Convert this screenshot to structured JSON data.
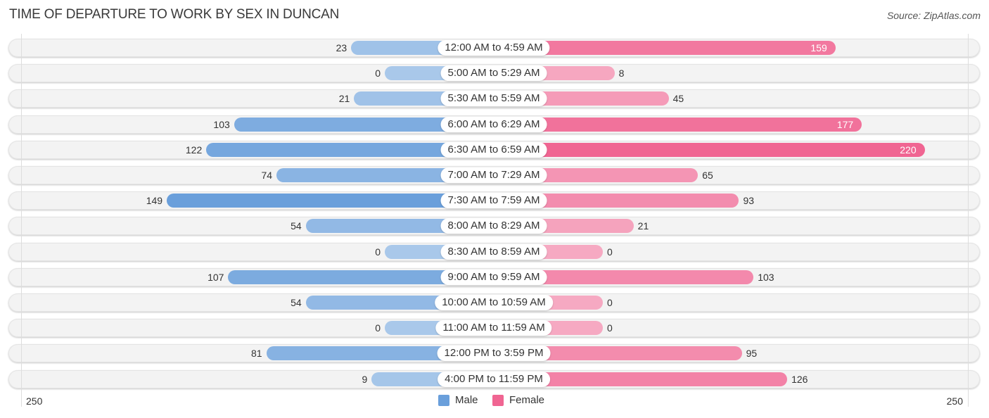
{
  "title": "TIME OF DEPARTURE TO WORK BY SEX IN DUNCAN",
  "source": "Source: ZipAtlas.com",
  "colors": {
    "male": "#6a9fdb",
    "male_light": "#a9c8ea",
    "female": "#f06592",
    "female_light": "#f6a9c2"
  },
  "chart_data": {
    "type": "bar",
    "orientation": "horizontal-diverging",
    "title": "TIME OF DEPARTURE TO WORK BY SEX IN DUNCAN",
    "categories": [
      "12:00 AM to 4:59 AM",
      "5:00 AM to 5:29 AM",
      "5:30 AM to 5:59 AM",
      "6:00 AM to 6:29 AM",
      "6:30 AM to 6:59 AM",
      "7:00 AM to 7:29 AM",
      "7:30 AM to 7:59 AM",
      "8:00 AM to 8:29 AM",
      "8:30 AM to 8:59 AM",
      "9:00 AM to 9:59 AM",
      "10:00 AM to 10:59 AM",
      "11:00 AM to 11:59 AM",
      "12:00 PM to 3:59 PM",
      "4:00 PM to 11:59 PM"
    ],
    "series": [
      {
        "name": "Male",
        "values": [
          23,
          0,
          21,
          103,
          122,
          74,
          149,
          54,
          0,
          107,
          54,
          0,
          81,
          9
        ]
      },
      {
        "name": "Female",
        "values": [
          159,
          8,
          45,
          177,
          220,
          65,
          93,
          21,
          0,
          103,
          0,
          0,
          95,
          126
        ]
      }
    ],
    "axis": {
      "left_label": "250",
      "right_label": "250",
      "range": [
        0,
        250
      ]
    },
    "legend": {
      "position": "bottom-center",
      "items": [
        "Male",
        "Female"
      ]
    },
    "grid": false
  }
}
